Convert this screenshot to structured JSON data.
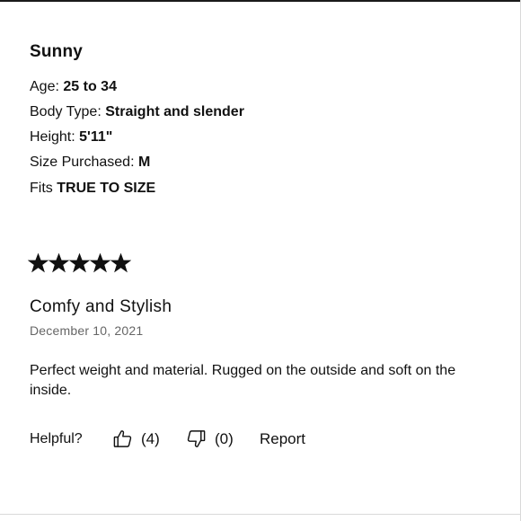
{
  "reviewer": {
    "name": "Sunny",
    "age_label": "Age:",
    "age_value": "25 to 34",
    "body_type_label": "Body Type:",
    "body_type_value": "Straight and slender",
    "height_label": "Height:",
    "height_value": "5'11\"",
    "size_label": "Size Purchased:",
    "size_value": "M",
    "fit_label": "Fits",
    "fit_value": "TRUE TO SIZE"
  },
  "review": {
    "rating": 5,
    "rating_max": 5,
    "title": "Comfy and Stylish",
    "date": "December 10, 2021",
    "body": "Perfect weight and material. Rugged on the outside and soft on the inside."
  },
  "feedback": {
    "helpful_label": "Helpful?",
    "helpful_count": "(4)",
    "unhelpful_count": "(0)",
    "report_label": "Report"
  },
  "icons": {
    "star": "star-icon",
    "thumbs_up": "thumbs-up-icon",
    "thumbs_down": "thumbs-down-icon"
  }
}
